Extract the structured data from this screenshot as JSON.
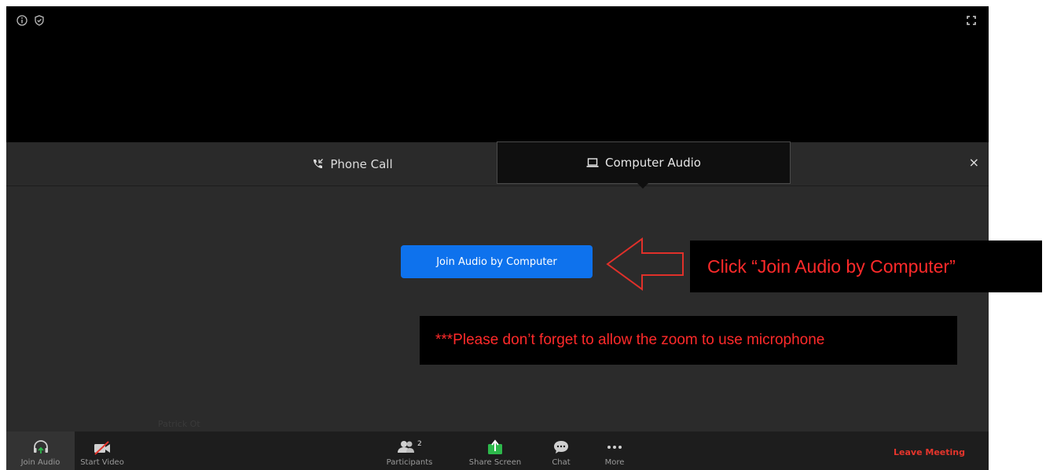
{
  "audio_dialog": {
    "tabs": [
      {
        "label": "Phone Call",
        "icon": "phone-icon"
      },
      {
        "label": "Computer Audio",
        "icon": "laptop-icon",
        "selected": true
      }
    ],
    "close_label": "×",
    "join_button": "Join Audio by Computer",
    "background_name": "Patrick Ot"
  },
  "toolbar": {
    "join_audio": "Join Audio",
    "start_video": "Start Video",
    "participants": "Participants",
    "participants_count": "2",
    "share_screen": "Share Screen",
    "chat": "Chat",
    "more": "More",
    "leave": "Leave Meeting"
  },
  "annotations": {
    "callout_main": "Click “Join Audio by Computer”",
    "callout_note": "***Please don’t forget to allow the zoom to use microphone"
  },
  "colors": {
    "accent": "#0e72ed",
    "leave": "#e5352c",
    "share": "#2db84b",
    "annotation": "#ff2a2a"
  }
}
